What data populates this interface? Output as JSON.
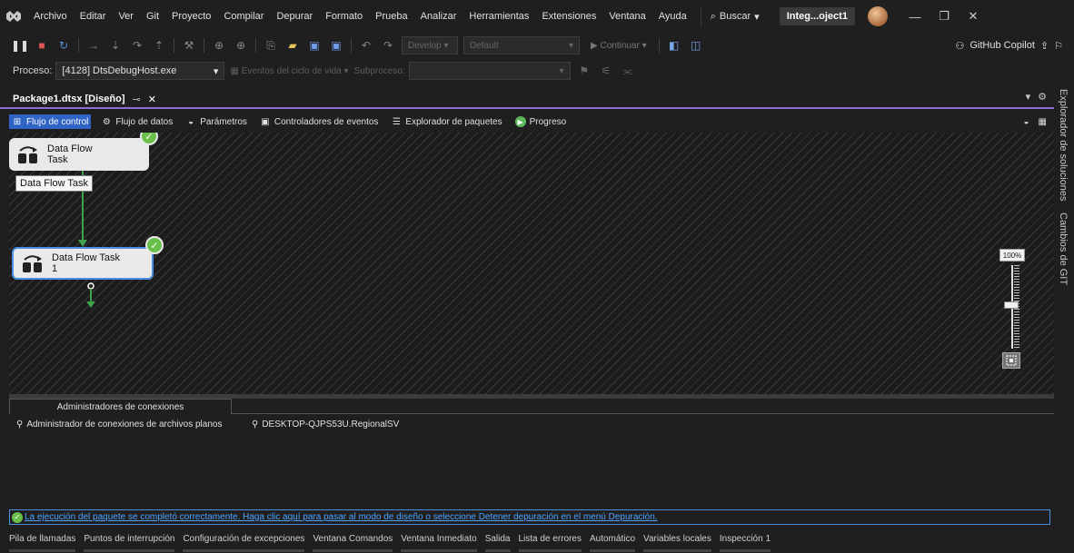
{
  "menu": {
    "items": [
      "Archivo",
      "Editar",
      "Ver",
      "Git",
      "Proyecto",
      "Compilar",
      "Depurar",
      "Formato",
      "Prueba",
      "Analizar",
      "Herramientas",
      "Extensiones",
      "Ventana",
      "Ayuda"
    ],
    "search_label": "Buscar",
    "project_badge": "Integ...oject1"
  },
  "toolbar": {
    "config_dropdown": "Develop",
    "platform_dropdown": "Default",
    "continue_label": "Continuar",
    "copilot_label": "GitHub Copilot"
  },
  "debug_toolbar": {
    "process_label": "Proceso:",
    "process_value": "[4128] DtsDebugHost.exe",
    "lifecycle_label": "Eventos del ciclo de vida",
    "thread_label": "Subproceso:"
  },
  "document_tab": {
    "title": "Package1.dtsx [Diseño]"
  },
  "designer_tabs": [
    "Flujo de control",
    "Flujo de datos",
    "Parámetros",
    "Controladores de eventos",
    "Explorador de paquetes",
    "Progreso"
  ],
  "canvas": {
    "task1": {
      "line1": "Data Flow",
      "line2": "Task"
    },
    "tooltip": "Data Flow Task",
    "task2": {
      "line1": "Data Flow Task",
      "line2": "1"
    },
    "zoom_label": "100%"
  },
  "side_tabs": [
    "Explorador de soluciones",
    "Cambios de GIT"
  ],
  "connections": {
    "tab_label": "Administradores de conexiones",
    "items": [
      "Administrador de conexiones de archivos planos",
      "DESKTOP-QJPS53U.RegionalSV"
    ]
  },
  "status_message": "La ejecución del paquete se completó correctamente. Haga clic aquí para pasar al modo de diseño o seleccione Detener depuración en el menú Depuración.",
  "bottom_tabs": [
    "Pila de llamadas",
    "Puntos de interrupción",
    "Configuración de excepciones",
    "Ventana Comandos",
    "Ventana Inmediato",
    "Salida",
    "Lista de errores",
    "Automático",
    "Variables locales",
    "Inspección 1"
  ],
  "colors": {
    "accent": "#8b6fd3",
    "active_tab": "#2f63c6",
    "success": "#6abf4b",
    "link": "#4ea3ff"
  }
}
